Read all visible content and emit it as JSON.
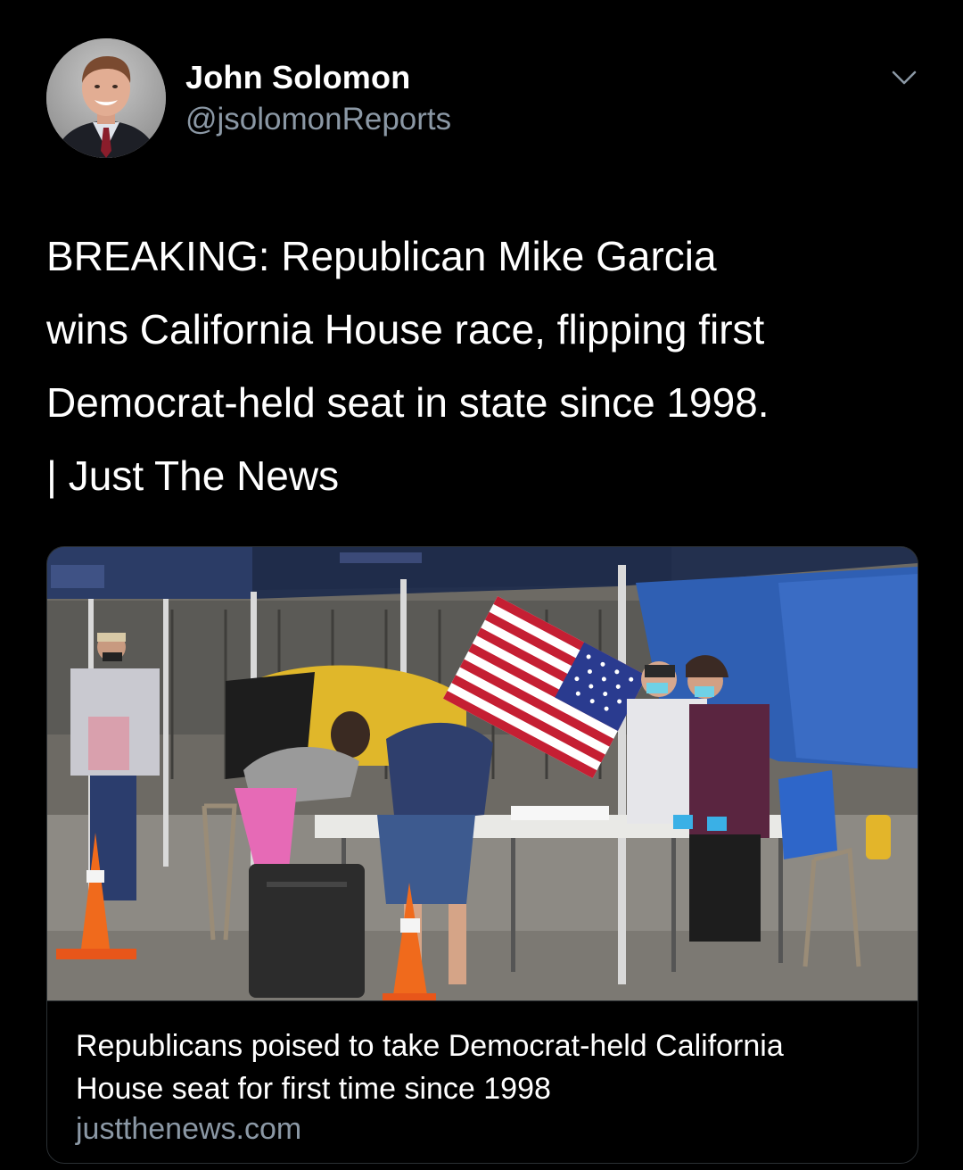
{
  "tweet": {
    "author": {
      "display_name": "John Solomon",
      "handle": "@jsolomonReports",
      "avatar_icon": "avatar-portrait"
    },
    "menu_icon": "chevron-down-icon",
    "text": "BREAKING: Republican Mike Garcia\nwins California House race, flipping first\nDemocrat-held seat in state since 1998.\n| Just The News"
  },
  "link_card": {
    "image_icon": "photo-voting-center",
    "title": "Republicans poised to take Democrat-held California House seat for first time since 1998",
    "domain": "justthenews.com"
  },
  "colors": {
    "background": "#000000",
    "primary_text": "#ffffff",
    "secondary_text": "#8b98a5",
    "card_border": "#2a2f33"
  }
}
